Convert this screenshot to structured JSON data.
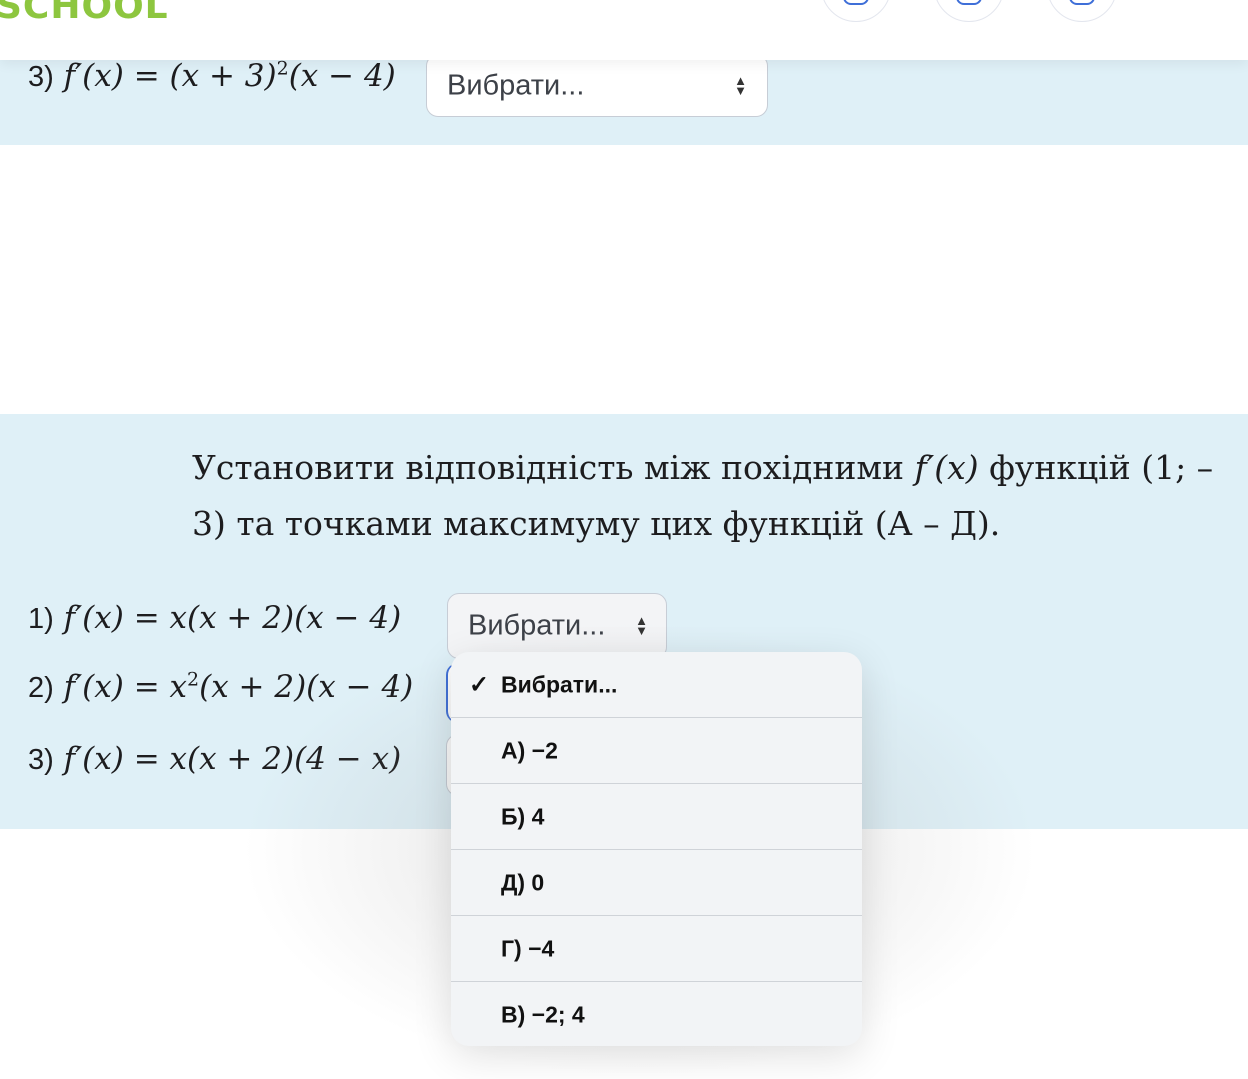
{
  "header": {
    "logo": "SCHOOL"
  },
  "prev_question": {
    "row3": {
      "num": "3)",
      "formula_prefix": "f′(x) = (x + 3)",
      "formula_sup": "2",
      "formula_suffix": "(x − 4)",
      "select_value": "Вибрати..."
    }
  },
  "question": {
    "text_a": "Установити відповідність між похідними ",
    "text_fx": "f′(x)",
    "text_b": " функцій (1; – 3) та точками максимуму цих функцій (А – Д).",
    "rows": [
      {
        "num": "1)",
        "formula": "f′(x) = x(x + 2)(x − 4)",
        "select_value": "Вибрати..."
      },
      {
        "num": "2)",
        "formula_prefix": "f′(x) = x",
        "formula_sup": "2",
        "formula_suffix": "(x + 2)(x − 4)"
      },
      {
        "num": "3)",
        "formula": "f′(x) = x(x + 2)(4 − x)"
      }
    ]
  },
  "dropdown": {
    "options": [
      {
        "label": "Вибрати...",
        "checked": true
      },
      {
        "label": "А) −2"
      },
      {
        "label": "Б) 4"
      },
      {
        "label": "Д) 0"
      },
      {
        "label": "Г) −4"
      },
      {
        "label": "В) −2; 4"
      }
    ],
    "check_glyph": "✓"
  },
  "colors": {
    "card_bg": "#dff0f7",
    "logo": "#8dc63f",
    "icon_blue": "#3f6fd8"
  }
}
